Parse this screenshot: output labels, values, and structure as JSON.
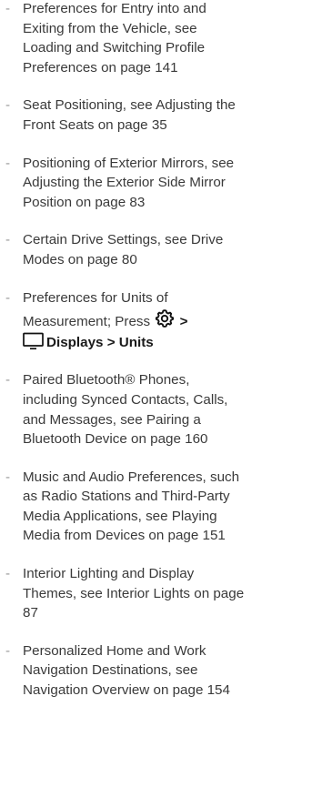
{
  "list": {
    "items": [
      "Preferences for Entry into and\nExiting from the Vehicle, see\nLoading and Switching Profile\nPreferences on page 141",
      "Seat Positioning, see Adjusting the\nFront Seats on page 35",
      "Positioning of Exterior Mirrors, see\nAdjusting the Exterior Side Mirror\nPosition on page 83",
      "Certain Drive Settings, see Drive\nModes on page 80",
      "",
      "Paired Bluetooth® Phones,\nincluding Synced Contacts, Calls,\nand Messages, see Pairing a\nBluetooth Device on page 160",
      "Music and Audio Preferences, such\nas Radio Stations and Third-Party\nMedia Applications, see Playing\nMedia from Devices on page 151",
      "Interior Lighting and Display\nThemes, see Interior Lights on page\n87",
      "Personalized Home and Work\nNavigation Destinations, see\nNavigation Overview on page 154"
    ],
    "units_item": {
      "line1": "Preferences for Units of",
      "line2_prefix": "Measurement; Press",
      "arrow": ">",
      "displays_units": "Displays > Units"
    }
  },
  "icons": {
    "gear": "gear-icon",
    "display": "display-icon"
  },
  "colors": {
    "text": "#3a3a3a",
    "bold_text": "#1a1a1a",
    "dash": "#9a9a9a"
  }
}
